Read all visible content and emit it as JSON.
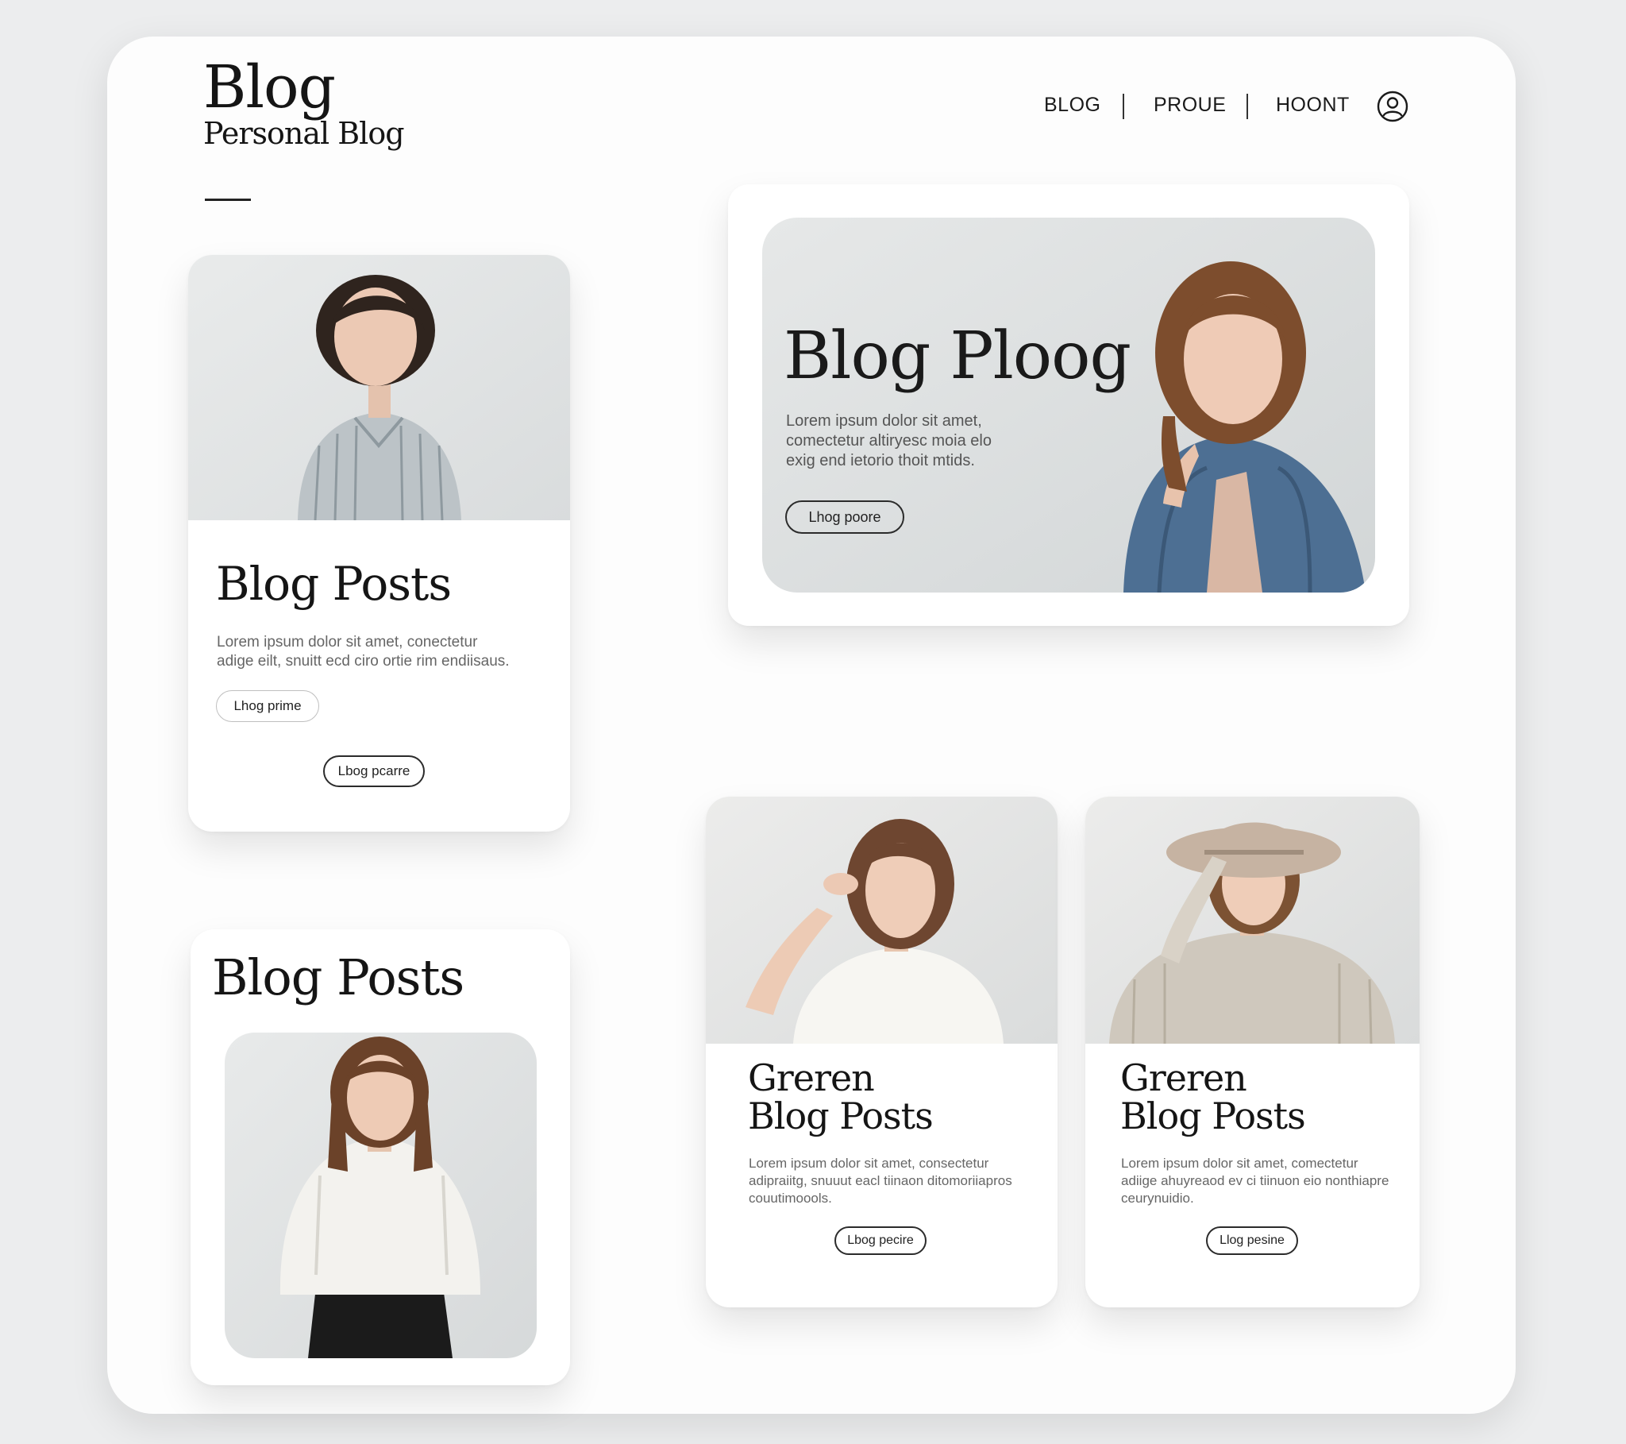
{
  "brand": {
    "title": "Blog",
    "subtitle": "Personal Blog"
  },
  "nav": {
    "items": [
      "BLOG",
      "PROUE",
      "HOONT"
    ],
    "user_icon": "user-circle-icon"
  },
  "featured": {
    "title": "Blog Ploog",
    "text": [
      "Lorem ipsum dolor sit amet,",
      "comectetur altiryesc moia elo",
      "exig end ietorio thoit mtids."
    ],
    "button": "Lhog poore"
  },
  "post_card_1": {
    "title": "Blog Posts",
    "text": [
      "Lorem ipsum dolor sit amet, conectetur",
      "adige eilt, snuitt ecd ciro ortie rim endiisaus."
    ],
    "button_1": "Lhog prime",
    "button_2": "Lbog pcarre"
  },
  "post_card_2": {
    "title": "Blog Posts"
  },
  "post_card_3": {
    "title_line_1": "Greren",
    "title_line_2": "Blog Posts",
    "text": [
      "Lorem ipsum dolor sit amet, consectetur",
      "adipraiitg, snuuut eacl tiinaon ditomoriiapros",
      "couutimoools."
    ],
    "button": "Lbog pecire"
  },
  "post_card_4": {
    "title_line_1": "Greren",
    "title_line_2": "Blog Posts",
    "text": [
      "Lorem ipsum dolor sit amet, comectetur",
      "adiige ahuyreaod ev ci tiinuon eio nonthiapre",
      "ceurynuidio."
    ],
    "button": "Llog pesine"
  }
}
